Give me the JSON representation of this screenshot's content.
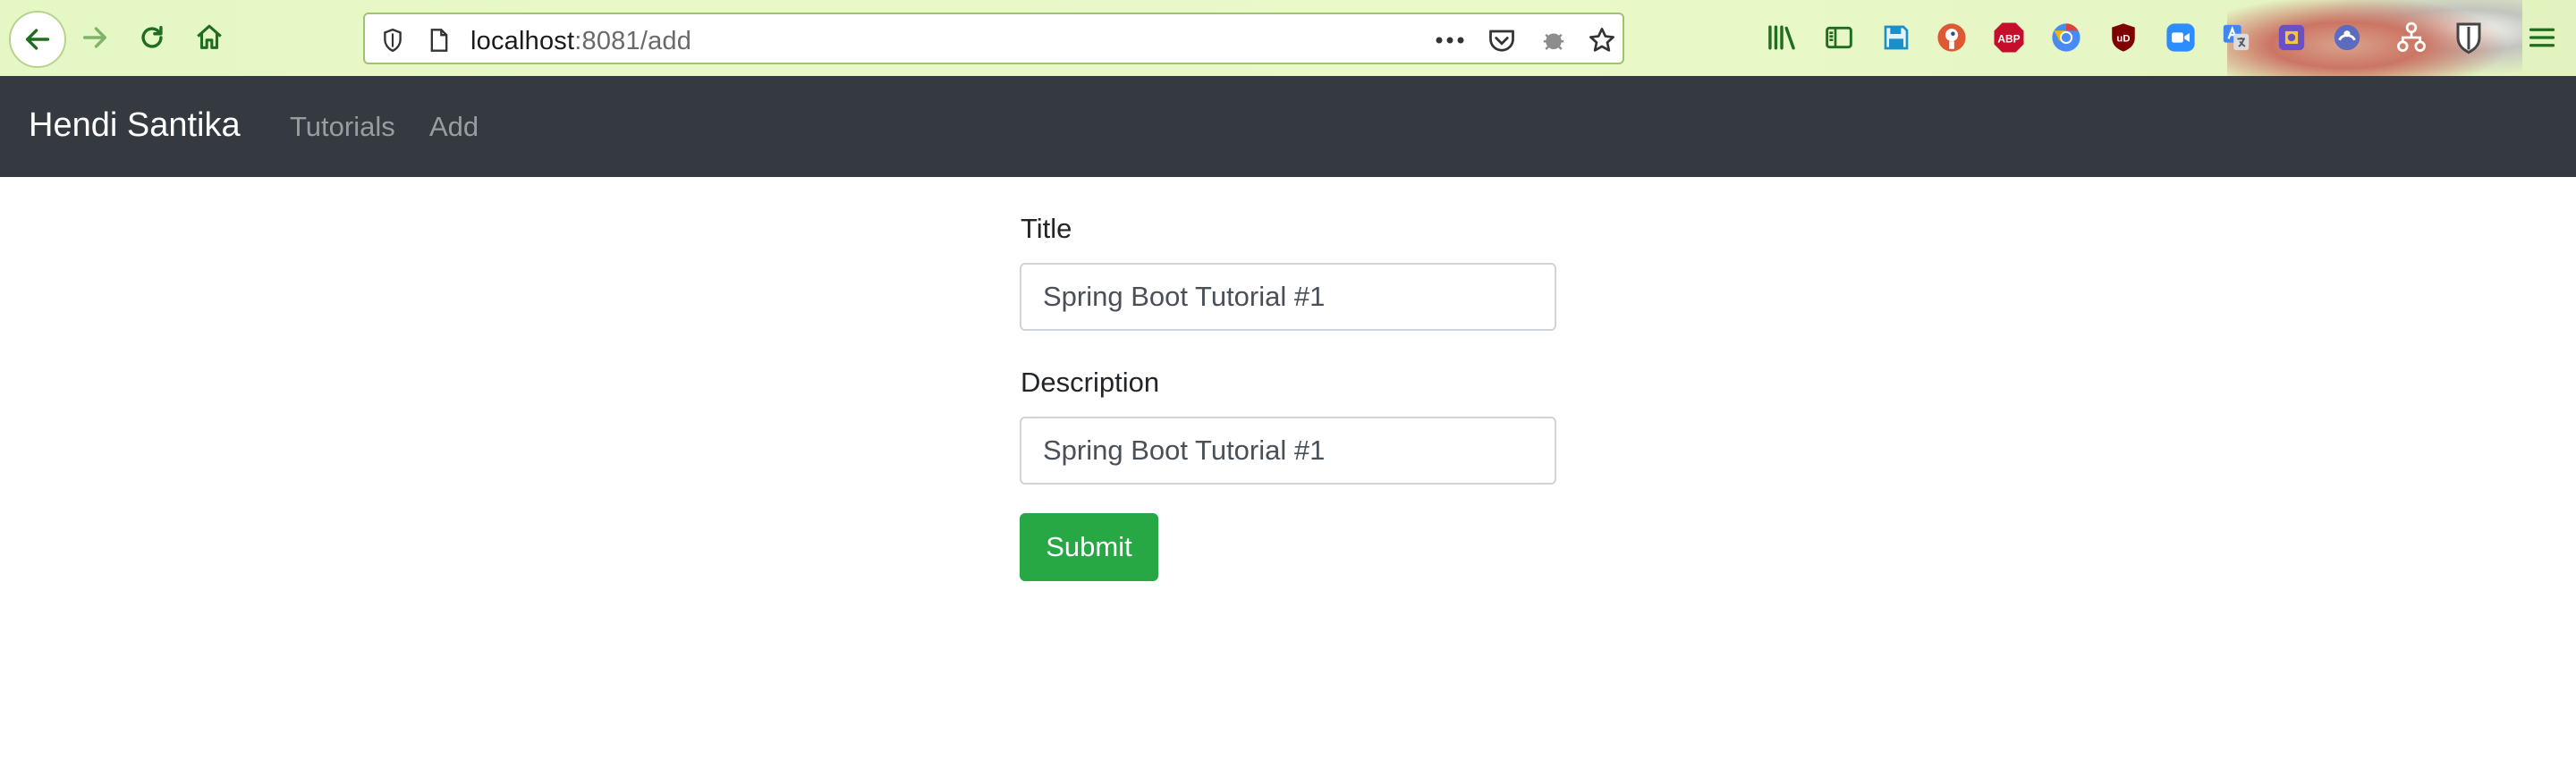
{
  "browser": {
    "url_host": "localhost",
    "url_rest": ":8081/add",
    "toolbar_icons": [
      "back-icon",
      "forward-icon",
      "reload-icon",
      "home-icon",
      "shield-icon",
      "page-icon",
      "more-icon",
      "pocket-icon",
      "bug-icon",
      "star-icon"
    ],
    "extension_icons": [
      "library-icon",
      "sidebar-icon",
      "save-icon",
      "duckduckgo-icon",
      "adblock-icon",
      "chrome-icon",
      "ublock-icon",
      "zoom-icon",
      "translate-icon",
      "extension-icon",
      "extension-icon",
      "network-icon",
      "bitwarden-icon",
      "menu-icon"
    ],
    "adblock_label": "ABP",
    "ublock_label": "uD"
  },
  "navbar": {
    "brand": "Hendi Santika",
    "links": [
      {
        "label": "Tutorials"
      },
      {
        "label": "Add"
      }
    ]
  },
  "form": {
    "title_label": "Title",
    "title_value": "Spring Boot Tutorial #1",
    "description_label": "Description",
    "description_value": "Spring Boot Tutorial #1",
    "submit_label": "Submit"
  },
  "colors": {
    "navbar_bg": "#343a40",
    "submit_bg": "#28a745",
    "toolbar_bg": "#e6f7c6"
  }
}
